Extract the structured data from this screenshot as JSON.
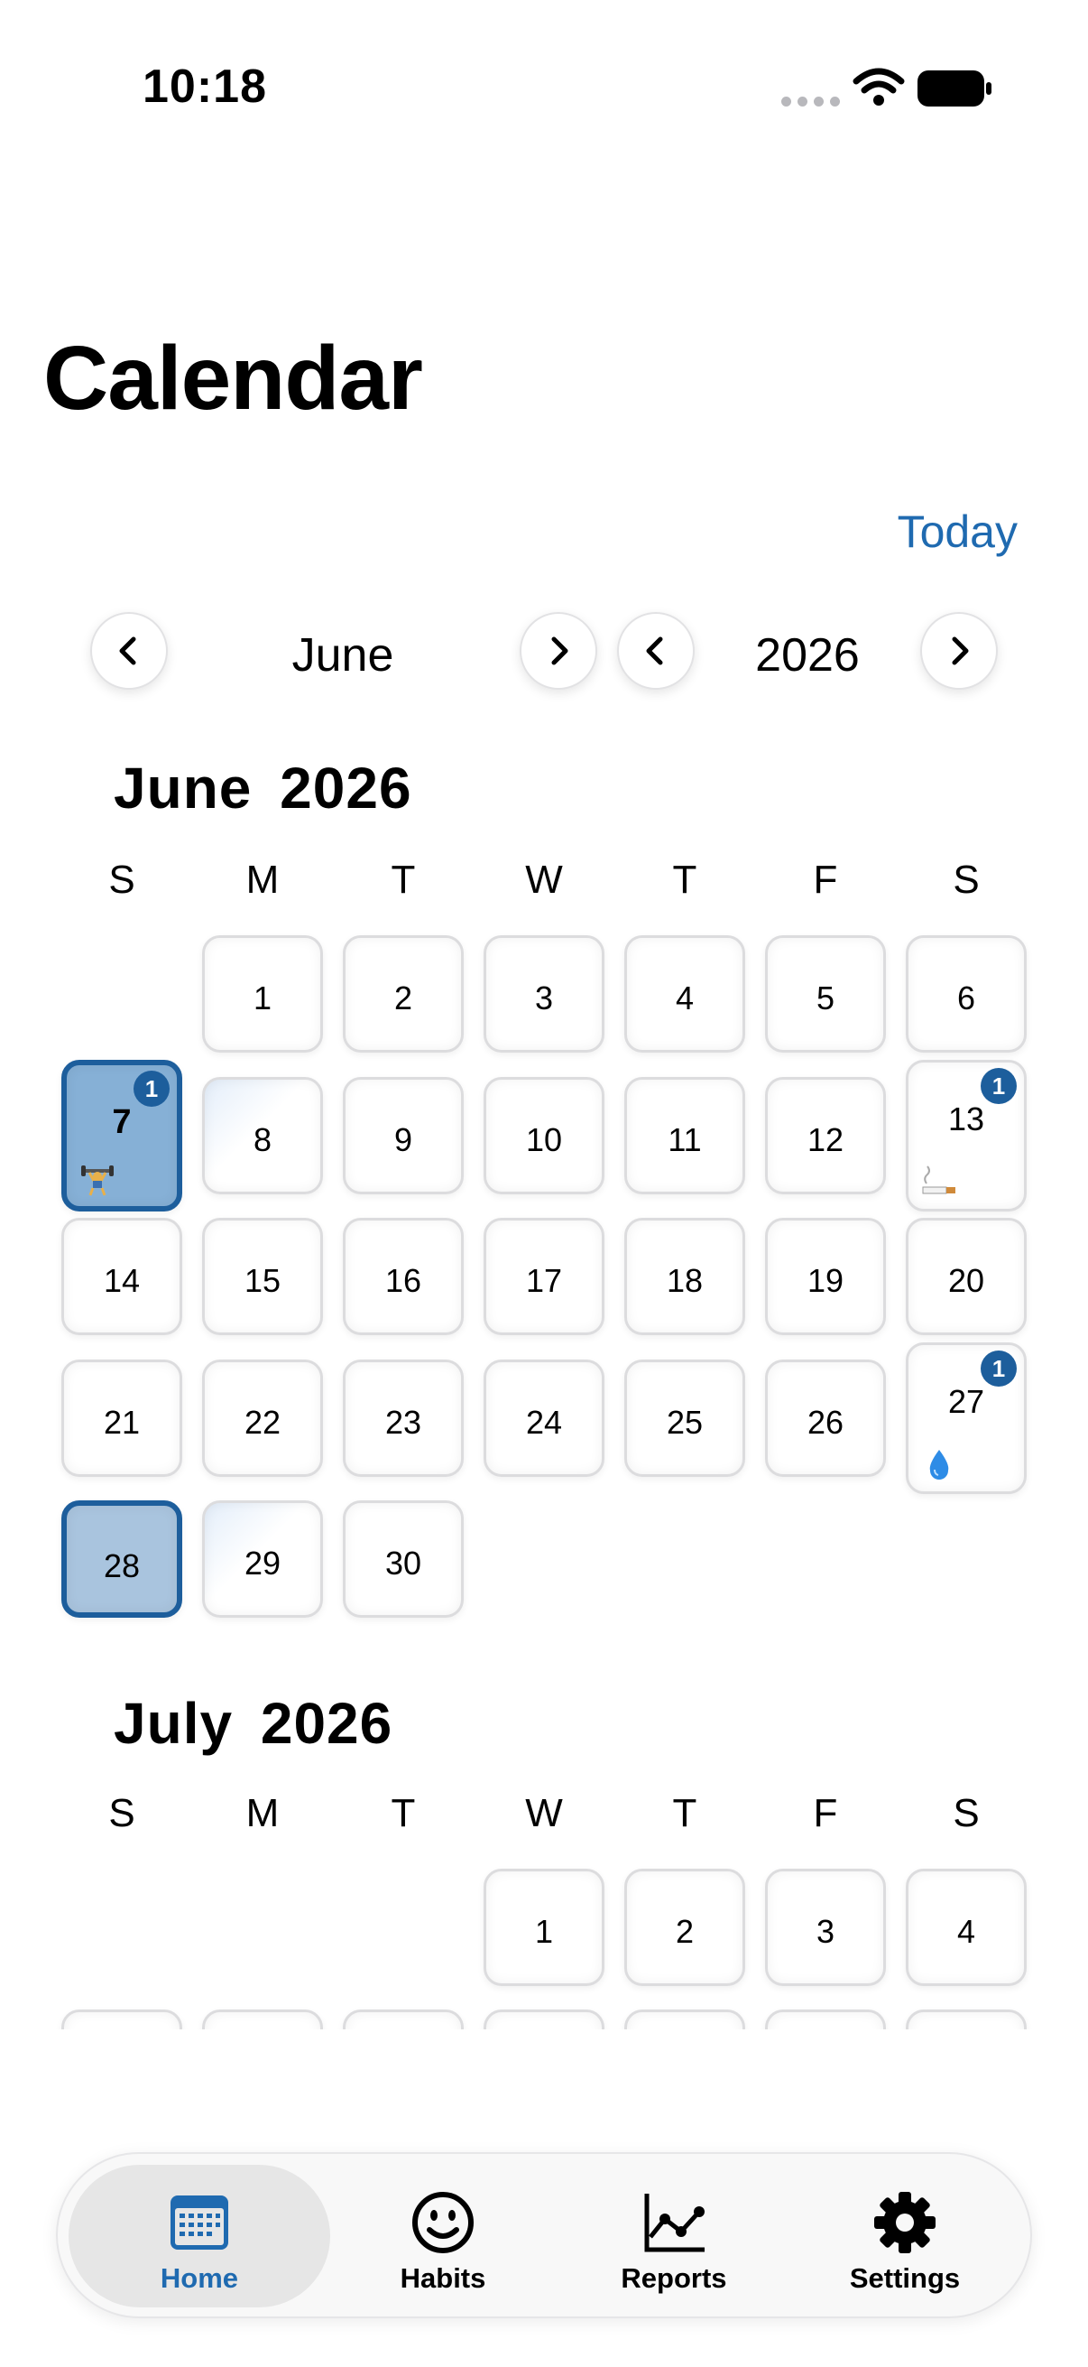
{
  "status_bar": {
    "time": "10:18"
  },
  "header": {
    "title": "Calendar",
    "today_label": "Today"
  },
  "navigator": {
    "month": "June",
    "year": "2026"
  },
  "weekdays": [
    "S",
    "M",
    "T",
    "W",
    "T",
    "F",
    "S"
  ],
  "months": [
    {
      "title": "June 2026",
      "days": {
        "d1": "1",
        "d2": "2",
        "d3": "3",
        "d4": "4",
        "d5": "5",
        "d6": "6",
        "d7": "7",
        "d8": "8",
        "d9": "9",
        "d10": "10",
        "d11": "11",
        "d12": "12",
        "d13": "13",
        "d14": "14",
        "d15": "15",
        "d16": "16",
        "d17": "17",
        "d18": "18",
        "d19": "19",
        "d20": "20",
        "d21": "21",
        "d22": "22",
        "d23": "23",
        "d24": "24",
        "d25": "25",
        "d26": "26",
        "d27": "27",
        "d28": "28",
        "d29": "29",
        "d30": "30"
      },
      "badges": {
        "d7": "1",
        "d13": "1",
        "d27": "1"
      },
      "emoji_icons": {
        "d7": "weightlifter-icon",
        "d13": "cigarette-icon",
        "d27": "water-drop-icon"
      }
    },
    {
      "title": "July 2026",
      "days": {
        "d1": "1",
        "d2": "2",
        "d3": "3",
        "d4": "4"
      }
    }
  ],
  "tabs": [
    {
      "label": "Home",
      "icon": "calendar-icon",
      "active": true
    },
    {
      "label": "Habits",
      "icon": "smiley-icon"
    },
    {
      "label": "Reports",
      "icon": "line-chart-icon"
    },
    {
      "label": "Settings",
      "icon": "gear-icon"
    }
  ],
  "colors": {
    "accent": "#1f6ab0",
    "selected_border": "#1d5e9c",
    "selected_fill": "#86b0d6"
  }
}
